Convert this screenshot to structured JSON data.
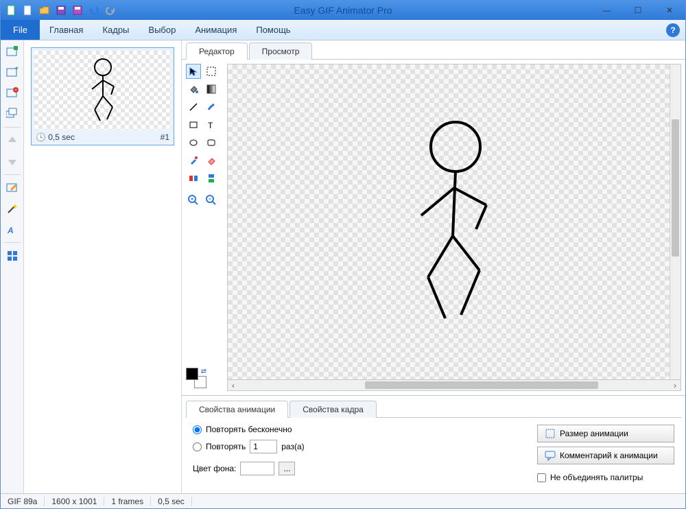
{
  "app": {
    "title": "Easy GIF Animator Pro"
  },
  "menu": {
    "file": "File",
    "items": [
      "Главная",
      "Кадры",
      "Выбор",
      "Анимация",
      "Помощь"
    ]
  },
  "frames": {
    "frame1": {
      "duration": "0,5 sec",
      "number": "#1"
    }
  },
  "editor": {
    "tabs": {
      "editor": "Редактор",
      "preview": "Просмотр"
    }
  },
  "props": {
    "tabs": {
      "anim": "Свойства анимации",
      "frame": "Свойства кадра"
    },
    "repeat_infinite": "Повторять бесконечно",
    "repeat": "Повторять",
    "repeat_value": "1",
    "times": "раз(а)",
    "bgcolor_label": "Цвет фона:",
    "btn_size": "Размер анимации",
    "btn_comment": "Комментарий к анимации",
    "no_merge": "Не объединять палитры"
  },
  "status": {
    "format": "GIF 89a",
    "dims": "1600 x 1001",
    "frames": "1 frames",
    "time": "0,5 sec"
  }
}
